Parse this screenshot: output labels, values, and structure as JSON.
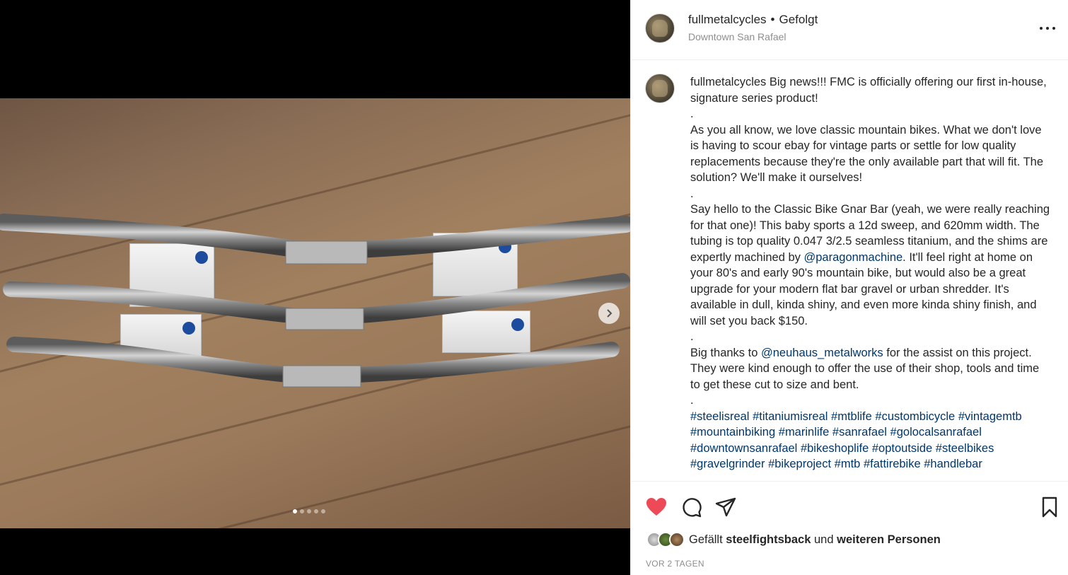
{
  "post": {
    "username": "fullmetalcycles",
    "separator": "•",
    "follow_status": "Gefolgt",
    "location": "Downtown San Rafael",
    "image_count": 5,
    "current_image": 1
  },
  "caption": {
    "username": "fullmetalcycles",
    "intro": " Big news!!! FMC is officially offering our first in-house, signature series product!",
    "dot1": ".",
    "para1": "As you all know, we love classic mountain bikes. What we don't love is having to scour ebay for vintage parts or settle for low quality replacements because they're the only available part that will fit. The solution? We'll make it ourselves!",
    "dot2": ".",
    "para2_a": "Say hello to the Classic Bike Gnar Bar (yeah, we were really reaching for that one)! This baby sports a 12d sweep, and 620mm width. The tubing is top quality 0.047 3/2.5 seamless titanium, and the shims are expertly machined by ",
    "mention1": "@paragonmachine",
    "para2_b": ". It'll feel right at home on your 80's and early 90's mountain bike, but would also be a great upgrade for your modern flat bar gravel or urban shredder. It's available in dull, kinda shiny, and even more kinda shiny finish, and will set you back $150.",
    "dot3": ".",
    "para3_a": "Big thanks to ",
    "mention2": "@neuhaus_metalworks",
    "para3_b": " for the assist on this project. They were kind enough to offer the use of their shop, tools and time to get these cut to size and bent.",
    "dot4": ".",
    "hashtags": [
      "#steelisreal",
      "#titaniumisreal",
      "#mtblife",
      "#custombicycle",
      "#vintagemtb",
      "#mountainbiking",
      "#marinlife",
      "#sanrafael",
      "#golocalsanrafael",
      "#downtownsanrafael",
      "#bikeshoplife",
      "#optoutside",
      "#steelbikes",
      "#gravelgrinder",
      "#bikeproject",
      "#mtb",
      "#fattirebike",
      "#handlebar"
    ]
  },
  "likes": {
    "prefix": "Gefällt ",
    "user": "steelfightsback",
    "middle": " und ",
    "others": "weiteren Personen"
  },
  "timestamp": "VOR 2 TAGEN",
  "colors": {
    "like_red": "#ed4956",
    "link_blue": "#00376b",
    "muted_gray": "#8e8e8e"
  },
  "icons": {
    "like": "heart-icon",
    "comment": "comment-icon",
    "share": "paper-plane-icon",
    "save": "bookmark-icon",
    "next": "chevron-right-icon",
    "more": "ellipsis-icon"
  }
}
